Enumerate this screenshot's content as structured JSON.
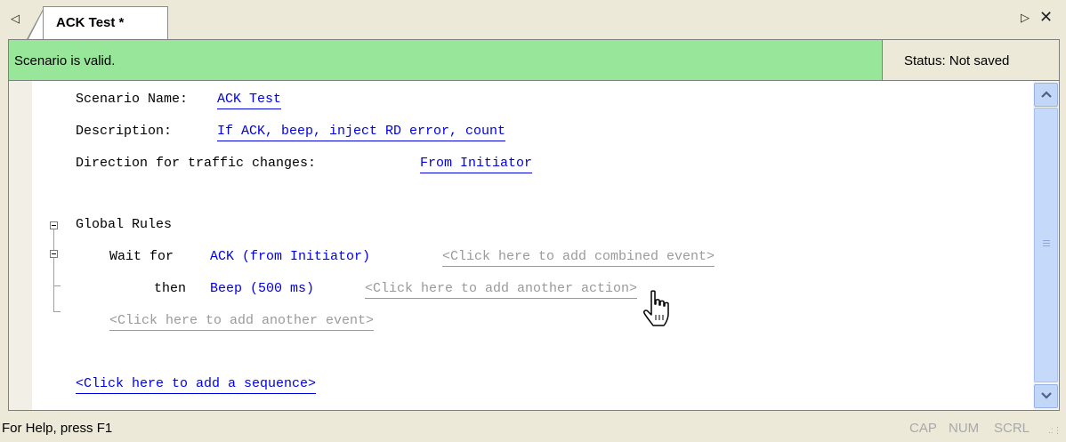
{
  "tabs": {
    "active_label": "ACK Test *"
  },
  "status": {
    "validity": "Scenario is valid.",
    "save_state": "Status: Not saved",
    "validity_color": "#98e69a"
  },
  "scenario": {
    "name_label": "Scenario Name:",
    "name_value": "ACK Test",
    "description_label": "Description:",
    "description_value": "If ACK, beep, inject RD error, count",
    "direction_label": "Direction for traffic changes:",
    "direction_value": "From Initiator"
  },
  "rules": {
    "heading": "Global Rules",
    "wait_label": "Wait for",
    "event_value": "ACK (from Initiator)",
    "add_combined_event": "<Click here to add combined event>",
    "then_label": "then",
    "action_value": "Beep (500 ms)",
    "add_another_action": "<Click here to add another action>",
    "add_another_event": "<Click here to add another event>",
    "add_sequence": "<Click here to add a sequence>"
  },
  "bottom": {
    "help": "For Help, press F1",
    "cap": "CAP",
    "num": "NUM",
    "scrl": "SCRL"
  },
  "icons": {
    "tab_scroll_left": "triangle-left-icon",
    "tab_scroll_right": "triangle-right-icon",
    "close": "close-icon",
    "pointer": "hand-cursor-icon"
  }
}
